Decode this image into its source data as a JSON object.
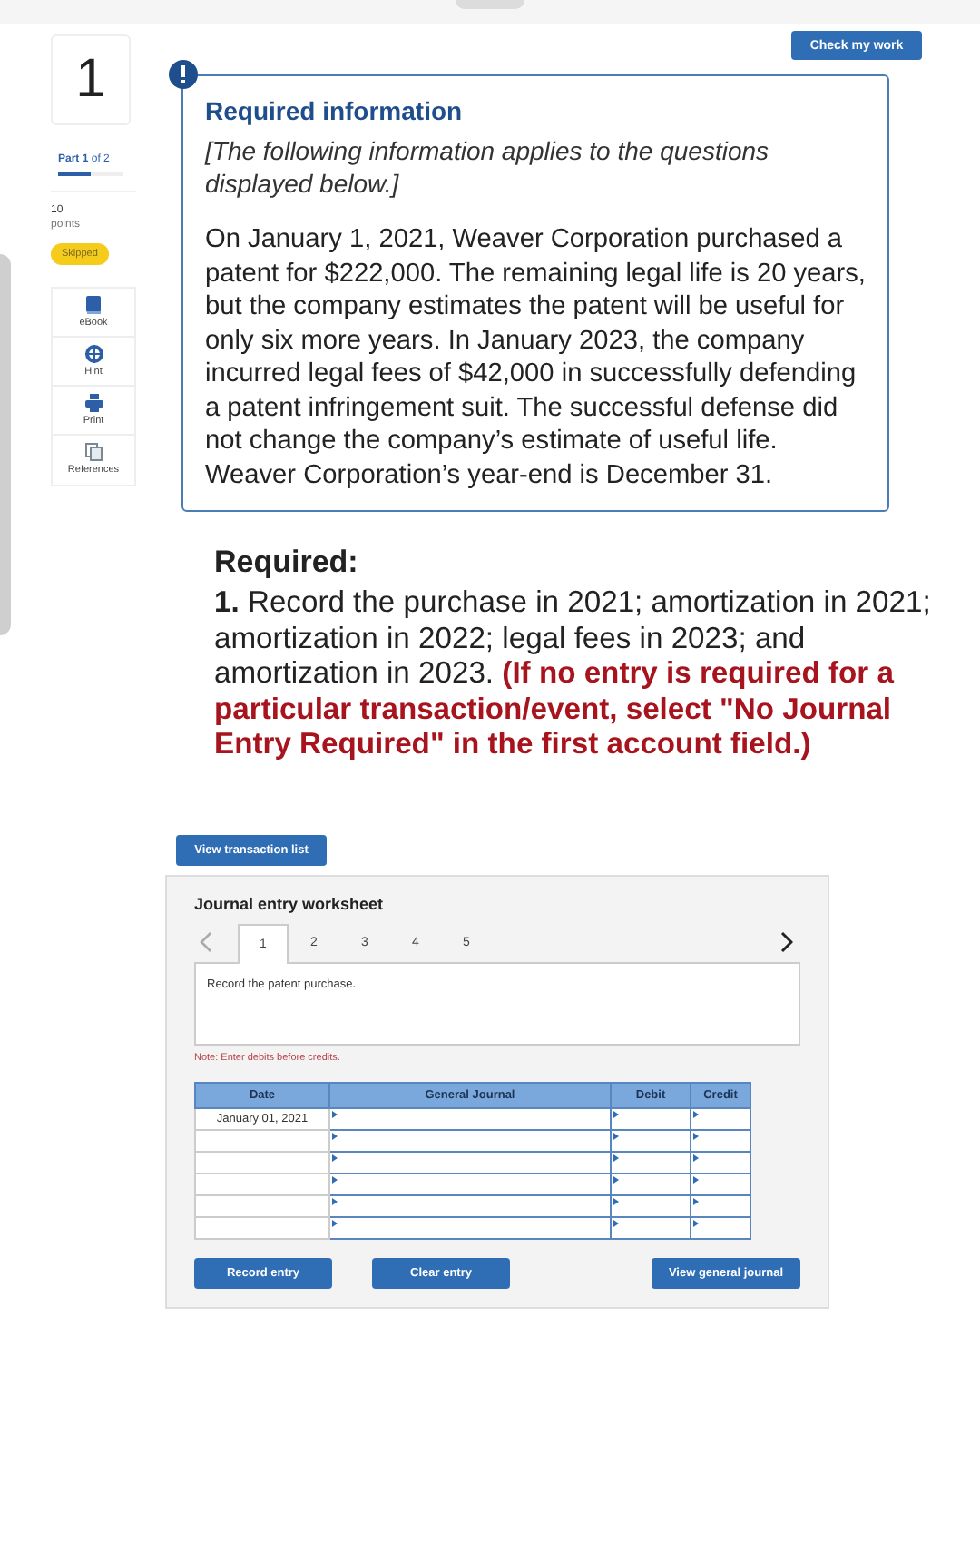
{
  "header": {
    "check_button": "Check my work"
  },
  "question": {
    "number": "1",
    "part": "**Part 1** of 2",
    "level": 0.5,
    "points": "10",
    "points_label": "points",
    "status": "Skipped"
  },
  "tools": [
    {
      "label": "eBook",
      "kind": "ebook"
    },
    {
      "label": "Hint",
      "kind": "hint"
    },
    {
      "label": "Print",
      "kind": "print"
    },
    {
      "label": "References",
      "kind": "references"
    }
  ],
  "info": {
    "title": "Required information",
    "subtitle": "[The following information applies to the questions displayed below.]",
    "body": "On January 1, 2021, Weaver Corporation purchased a patent for $222,000. The remaining legal life is 20 years, but the company estimates the patent will be useful for only six more years. In January 2023, the company incurred legal fees of $42,000 in successfully defending a patent infringement suit. The successful defense did not change the company’s estimate of useful life. Weaver Corporation’s year-end is December 31."
  },
  "required": {
    "heading": "Required:",
    "task": "**1.** Record the purchase in 2021; amortization in 2021; amortization in 2022; legal fees in 2023; and amortization in 2023.",
    "instruction": "(If no entry is required for a particular transaction/event, select \"No Journal Entry Required\" in the first account field.)"
  },
  "worksheet": {
    "view_button": "View transaction list",
    "title": "Journal entry worksheet",
    "tabs": [
      {
        "label": "1",
        "selected": true
      },
      {
        "label": "2",
        "selected": false
      },
      {
        "label": "3",
        "selected": false
      },
      {
        "label": "4",
        "selected": false
      },
      {
        "label": "5",
        "selected": false
      }
    ],
    "prompt": "Record the patent purchase.",
    "note": "Note: Enter debits before credits.",
    "columns": [
      "Date",
      "General Journal",
      "Debit",
      "Credit"
    ],
    "rows": [
      {
        "date": "January 01, 2021"
      },
      {},
      {},
      {},
      {},
      {}
    ],
    "buttons": [
      "Record entry",
      "Clear entry",
      "View general journal"
    ]
  }
}
